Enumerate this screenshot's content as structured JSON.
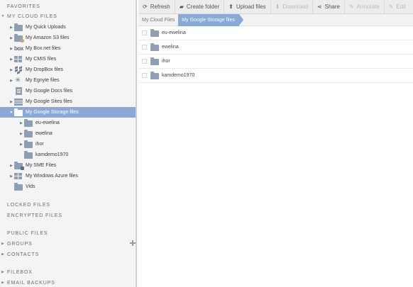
{
  "sidebar": {
    "favorites": "FAVORITES",
    "my_cloud_files": "MY CLOUD FILES",
    "items": [
      {
        "label": "My Quick Uploads"
      },
      {
        "label": "My Amazon S3 files"
      },
      {
        "label": "My Box.net files",
        "icon_text": "box"
      },
      {
        "label": "My CMIS files"
      },
      {
        "label": "My DropBox files"
      },
      {
        "label": "My Egnyte files"
      },
      {
        "label": "My Google Docs files"
      },
      {
        "label": "My Google Sites files"
      },
      {
        "label": "My Google Storage files"
      },
      {
        "label": "eu-ewelina"
      },
      {
        "label": "ewelina"
      },
      {
        "label": "ihor"
      },
      {
        "label": "kamdemo1970"
      },
      {
        "label": "My SME Files"
      },
      {
        "label": "My Windows Azure files"
      },
      {
        "label": "Vids"
      }
    ],
    "locked_files": "LOCKED FILES",
    "encrypted_files": "ENCRYPTED FILES",
    "public_files": "PUBLIC FILES",
    "groups": "GROUPS",
    "contacts": "CONTACTS",
    "filebox": "FILEBOX",
    "email_backups": "EMAIL BACKUPS"
  },
  "toolbar": {
    "refresh": "Refresh",
    "create_folder": "Create folder",
    "upload_files": "Upload files",
    "download": "Download",
    "share": "Share",
    "annotate": "Annotate",
    "edit": "Edit"
  },
  "breadcrumb": {
    "root": "My Cloud Files",
    "current": "My Google Storage files"
  },
  "files": [
    {
      "name": "eu-ewelina"
    },
    {
      "name": "ewelina"
    },
    {
      "name": "ihor"
    },
    {
      "name": "kamdemo1970"
    }
  ],
  "colors": {
    "selected": "#8aa9d6",
    "folder": "#8e9fb4"
  }
}
